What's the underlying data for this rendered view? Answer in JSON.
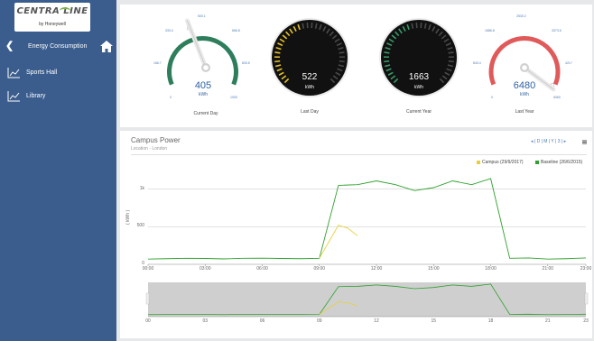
{
  "logo": {
    "brand": "CENTRA LINE",
    "sub": "by Honeywell"
  },
  "nav": {
    "title": "Energy Consumption",
    "back_icon": "chevron-left-icon",
    "home_icon": "home-icon",
    "items": [
      {
        "label": "Sports Hall",
        "icon": "chart-line-icon"
      },
      {
        "label": "Library",
        "icon": "chart-line-icon"
      }
    ]
  },
  "gauges": [
    {
      "caption": "Current Day",
      "value": "405",
      "unit": "kWh",
      "style": "light",
      "color": "#2e7d5b",
      "ticks": [
        "0",
        "166.7",
        "333.4",
        "500.1",
        "666.8",
        "833.5",
        "1000"
      ],
      "min": 0,
      "max": 1000,
      "reading": 405
    },
    {
      "caption": "Last Day",
      "value": "522",
      "unit": "kWh",
      "style": "dark",
      "color": "#e6c229",
      "fill_fraction": 0.45
    },
    {
      "caption": "Current Year",
      "value": "1663",
      "unit": "kWh",
      "style": "dark",
      "color": "#3a9a6a",
      "fill_fraction": 0.45
    },
    {
      "caption": "Last Year",
      "value": "6480",
      "unit": "kWh",
      "style": "light",
      "color": "#e05a5a",
      "ticks": [
        "0",
        "843.4",
        "1686.8",
        "2530.2",
        "3373.6",
        "4217",
        "5060"
      ],
      "min": 0,
      "max": 5060,
      "reading": 6480
    }
  ],
  "chart_panel": {
    "title": "Campus Power",
    "subtitle": "Location - London",
    "range_controls": "◂ | D | M | Y | 3 | ▸",
    "menu_icon": "hamburger-icon"
  },
  "chart_data": {
    "type": "line",
    "ylabel": "( kWh )",
    "ylim": [
      0,
      1200
    ],
    "yticks": [
      "0",
      "500",
      "1k"
    ],
    "xticks": [
      "00:00",
      "03:00",
      "06:00",
      "09:00",
      "12:00",
      "15:00",
      "18:00",
      "21:00",
      "23:00"
    ],
    "nav_xticks": [
      "00",
      "03",
      "06",
      "09",
      "12",
      "15",
      "18",
      "21",
      "23"
    ],
    "series": [
      {
        "name": "Campus (29/9/2017)",
        "color": "#e6d13a",
        "x": [
          9.0,
          10.0,
          10.5,
          11.0
        ],
        "y": [
          80,
          520,
          480,
          380
        ]
      },
      {
        "name": "Baseline (26/6/2015)",
        "color": "#2ea12e",
        "x": [
          0,
          1,
          2,
          3,
          4,
          5,
          6,
          7,
          8,
          9,
          10,
          11,
          12,
          13,
          14,
          15,
          16,
          17,
          18,
          19,
          20,
          21,
          22,
          23
        ],
        "y": [
          70,
          75,
          80,
          78,
          72,
          80,
          82,
          78,
          75,
          80,
          1050,
          1060,
          1110,
          1060,
          980,
          1020,
          1110,
          1060,
          1140,
          80,
          85,
          70,
          75,
          85
        ]
      }
    ]
  }
}
